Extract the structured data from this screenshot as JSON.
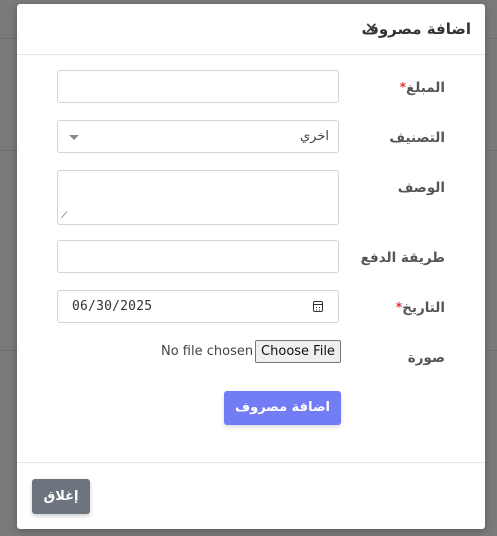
{
  "modal": {
    "title": "اضافة مصروف",
    "close_icon": "close-icon"
  },
  "form": {
    "amount": {
      "label": "المبلغ",
      "required": "*",
      "value": ""
    },
    "category": {
      "label": "التصنيف",
      "value": "اخري"
    },
    "description": {
      "label": "الوصف",
      "value": ""
    },
    "payment_method": {
      "label": "طريقة الدفع",
      "value": ""
    },
    "date": {
      "label": "التاريخ",
      "required": "*",
      "value": "06/30/2025",
      "icon": "calendar-icon"
    },
    "image": {
      "label": "صورة",
      "status": "No file chosen",
      "button": "Choose File"
    },
    "submit_label": "اضافة مصروف"
  },
  "footer": {
    "close_label": "إغلاق"
  },
  "colors": {
    "primary": "#727cf5",
    "secondary": "#6c757d",
    "required": "#e0303a",
    "overlay": "#7a7a7a"
  }
}
